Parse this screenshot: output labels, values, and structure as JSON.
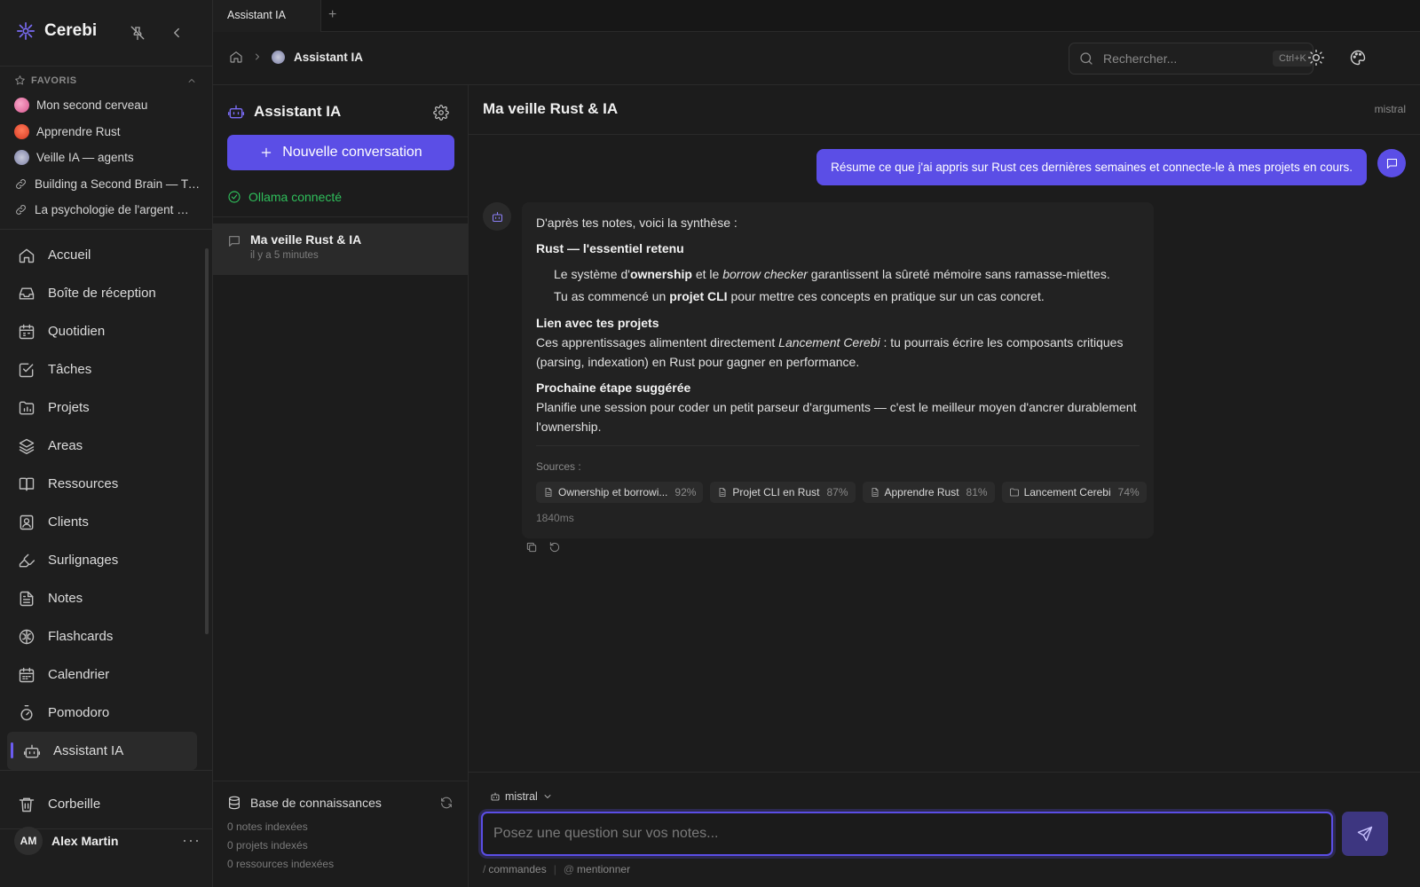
{
  "app": {
    "name": "Cerebi"
  },
  "colors": {
    "accent": "#5b4ee6",
    "success": "#2fbf5b",
    "background": "#1c1c1c"
  },
  "tabs": [
    {
      "label": "Assistant IA",
      "active": true
    }
  ],
  "tab_add": "+",
  "favorites": {
    "title": "FAVORIS",
    "items": [
      {
        "label": "Mon second cerveau",
        "icon": "brain-emoji"
      },
      {
        "label": "Apprendre Rust",
        "icon": "crab-emoji"
      },
      {
        "label": "Veille IA — agents",
        "icon": "robot-emoji"
      },
      {
        "label": "Building a Second Brain — Tia...",
        "icon": "link-icon"
      },
      {
        "label": "La psychologie de l'argent — ...",
        "icon": "link-icon"
      }
    ]
  },
  "nav": {
    "items": [
      {
        "label": "Accueil",
        "icon": "home-icon"
      },
      {
        "label": "Boîte de réception",
        "icon": "inbox-icon"
      },
      {
        "label": "Quotidien",
        "icon": "calendar-day-icon"
      },
      {
        "label": "Tâches",
        "icon": "check-square-icon"
      },
      {
        "label": "Projets",
        "icon": "folder-chart-icon"
      },
      {
        "label": "Areas",
        "icon": "layers-icon"
      },
      {
        "label": "Ressources",
        "icon": "book-icon"
      },
      {
        "label": "Clients",
        "icon": "contact-icon"
      },
      {
        "label": "Surlignages",
        "icon": "highlighter-icon"
      },
      {
        "label": "Notes",
        "icon": "file-text-icon"
      },
      {
        "label": "Flashcards",
        "icon": "brain-icon"
      },
      {
        "label": "Calendrier",
        "icon": "calendar-icon"
      },
      {
        "label": "Pomodoro",
        "icon": "timer-icon"
      },
      {
        "label": "Assistant IA",
        "icon": "bot-icon",
        "active": true
      }
    ],
    "trash": "Corbeille"
  },
  "user": {
    "initials": "AM",
    "name": "Alex Martin",
    "more": "···"
  },
  "header": {
    "breadcrumb_current": "Assistant IA",
    "search_placeholder": "Rechercher...",
    "search_shortcut": "Ctrl+K"
  },
  "conv_panel": {
    "title": "Assistant IA",
    "new_button": "Nouvelle conversation",
    "status": "Ollama connecté",
    "conversations": [
      {
        "name": "Ma veille Rust & IA",
        "time": "il y a 5 minutes"
      }
    ],
    "kb": {
      "title": "Base de connaissances",
      "stats": [
        "0 notes indexées",
        "0 projets indexés",
        "0 ressources indexées"
      ]
    }
  },
  "chat": {
    "title": "Ma veille Rust & IA",
    "model": "mistral",
    "user_message": "Résume ce que j'ai appris sur Rust ces dernières semaines et connecte-le à mes projets en cours.",
    "answer": {
      "intro": "D'après tes notes, voici la synthèse :",
      "s1_title": "Rust — l'essentiel retenu",
      "b1_a": "Le système d'",
      "b1_b": "ownership",
      "b1_c": " et le ",
      "b1_d": "borrow checker",
      "b1_e": " garantissent la sûreté mémoire sans ramasse-miettes.",
      "b2_a": "Tu as commencé un ",
      "b2_b": "projet CLI",
      "b2_c": " pour mettre ces concepts en pratique sur un cas concret.",
      "s2_title": "Lien avec tes projets",
      "p2_a": "Ces apprentissages alimentent directement ",
      "p2_b": "Lancement Cerebi",
      "p2_c": " : tu pourrais écrire les composants critiques (parsing, indexation) en Rust pour gagner en performance.",
      "s3_title": "Prochaine étape suggérée",
      "p3": "Planifie une session pour coder un petit parseur d'arguments — c'est le meilleur moyen d'ancrer durablement l'ownership.",
      "sources_label": "Sources :",
      "sources": [
        {
          "label": "Ownership et borrowi...",
          "pct": "92%",
          "icon": "file-icon"
        },
        {
          "label": "Projet CLI en Rust",
          "pct": "87%",
          "icon": "file-icon"
        },
        {
          "label": "Apprendre Rust",
          "pct": "81%",
          "icon": "file-icon"
        },
        {
          "label": "Lancement Cerebi",
          "pct": "74%",
          "icon": "folder-icon"
        }
      ],
      "latency": "1840ms"
    }
  },
  "composer": {
    "model": "mistral",
    "placeholder": "Posez une question sur vos notes...",
    "hint_commands": "commandes",
    "hint_mention": "mentionner",
    "sym_commands": "/",
    "sym_mention": "@"
  }
}
